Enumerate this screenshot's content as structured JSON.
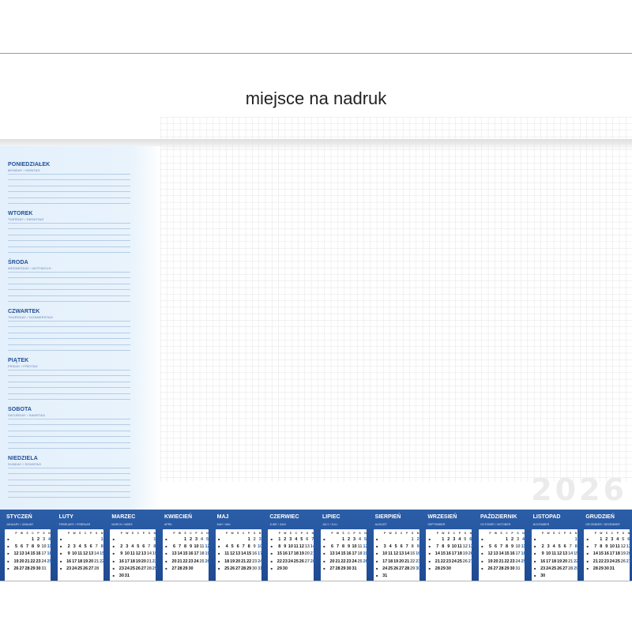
{
  "header": {
    "title": "miejsce na nadruk"
  },
  "year": "2026",
  "days": [
    {
      "name": "PONIEDZIAŁEK",
      "sub": "MONDAY / MONTAG"
    },
    {
      "name": "WTOREK",
      "sub": "TUESDAY / DIENSTAG"
    },
    {
      "name": "ŚRODA",
      "sub": "WEDNESDAY / MITTWOCH"
    },
    {
      "name": "CZWARTEK",
      "sub": "THURSDAY / DONNERSTAG"
    },
    {
      "name": "PIĄTEK",
      "sub": "FRIDAY / FREITAG"
    },
    {
      "name": "SOBOTA",
      "sub": "SATURDAY / SAMSTAG"
    },
    {
      "name": "NIEDZIELA",
      "sub": "SUNDAY / SONNTAG"
    }
  ],
  "dow": [
    "P",
    "W",
    "Ś",
    "C",
    "P",
    "S",
    "N"
  ],
  "months": [
    {
      "name": "STYCZEŃ",
      "sub": "JANUARY / JANUAR",
      "start": 3,
      "days": 31
    },
    {
      "name": "LUTY",
      "sub": "FEBRUARY / FEBRUAR",
      "start": 6,
      "days": 28
    },
    {
      "name": "MARZEC",
      "sub": "MARCH / MÄRZ",
      "start": 6,
      "days": 31
    },
    {
      "name": "KWIECIEŃ",
      "sub": "APRIL",
      "start": 2,
      "days": 30
    },
    {
      "name": "MAJ",
      "sub": "MAY / MAI",
      "start": 4,
      "days": 31
    },
    {
      "name": "CZERWIEC",
      "sub": "JUNE / JUNI",
      "start": 0,
      "days": 30
    },
    {
      "name": "LIPIEC",
      "sub": "JULY / JULI",
      "start": 2,
      "days": 31
    },
    {
      "name": "SIERPIEŃ",
      "sub": "AUGUST",
      "start": 5,
      "days": 31
    },
    {
      "name": "WRZESIEŃ",
      "sub": "SEPTEMBER",
      "start": 1,
      "days": 30
    },
    {
      "name": "PAŹDZIERNIK",
      "sub": "OCTOBER / OKTOBER",
      "start": 3,
      "days": 31
    },
    {
      "name": "LISTOPAD",
      "sub": "NOVEMBER",
      "start": 6,
      "days": 30
    },
    {
      "name": "GRUDZIEŃ",
      "sub": "DECEMBER / DEZEMBER",
      "start": 1,
      "days": 31
    }
  ]
}
